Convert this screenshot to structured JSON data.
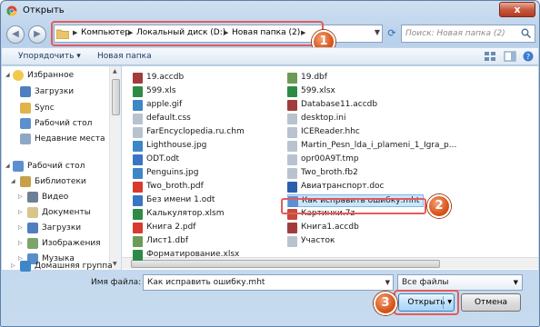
{
  "window": {
    "title": "Открыть",
    "close_label": "x"
  },
  "address": {
    "crumbs": [
      "Компьютер",
      "Локальный диск (D:)",
      "Новая папка (2)"
    ],
    "search_placeholder": "Поиск: Новая папка (2)"
  },
  "toolbar": {
    "organize": "Упорядочить ▾",
    "new_folder": "Новая папка"
  },
  "nav": {
    "favorites": "Избранное",
    "downloads": "Загрузки",
    "sync": "Sync",
    "desktop": "Рабочий стол",
    "recent": "Недавние места",
    "desktop_root": "Рабочий стол",
    "libraries": "Библиотеки",
    "video": "Видео",
    "documents": "Документы",
    "downloads2": "Загрузки",
    "pictures": "Изображения",
    "music": "Музыка",
    "homegroup": "Домашняя группа"
  },
  "files_col1": [
    "19.accdb",
    "599.xls",
    "apple.gif",
    "default.css",
    "FarEncyclopedia.ru.chm",
    "Lighthouse.jpg",
    "ODT.odt",
    "Penguins.jpg",
    "Two_broth.pdf",
    "Без имени 1.odt",
    "Калькулятор.xlsm",
    "Книга 2.pdf",
    "Лист1.dbf",
    "Форматирование.xlsx"
  ],
  "files_col2": [
    "19.dbf",
    "599.xlsx",
    "Database11.accdb",
    "desktop.ini",
    "ICEReader.hhc",
    "Martin_Pesn_lda_i_plameni_1_Igra_p...",
    "opr00A9T.tmp",
    "Two_broth.fb2",
    "Авиатранспорт.doc",
    "Как исправить ошибку.mht",
    "Картинки.7z",
    "Книга1.accdb",
    "Участок"
  ],
  "bottom": {
    "filename_label": "Имя файла:",
    "filename_value": "Как исправить ошибку.mht",
    "filter_value": "Все файлы",
    "open_label": "Открыть",
    "cancel_label": "Отмена"
  },
  "badges": [
    "1",
    "2",
    "3"
  ],
  "colors": {
    "accent": "#3c7fb1",
    "highlight": "#e25c5c",
    "badge": "#d9561a",
    "selection": "#cce5fb"
  }
}
